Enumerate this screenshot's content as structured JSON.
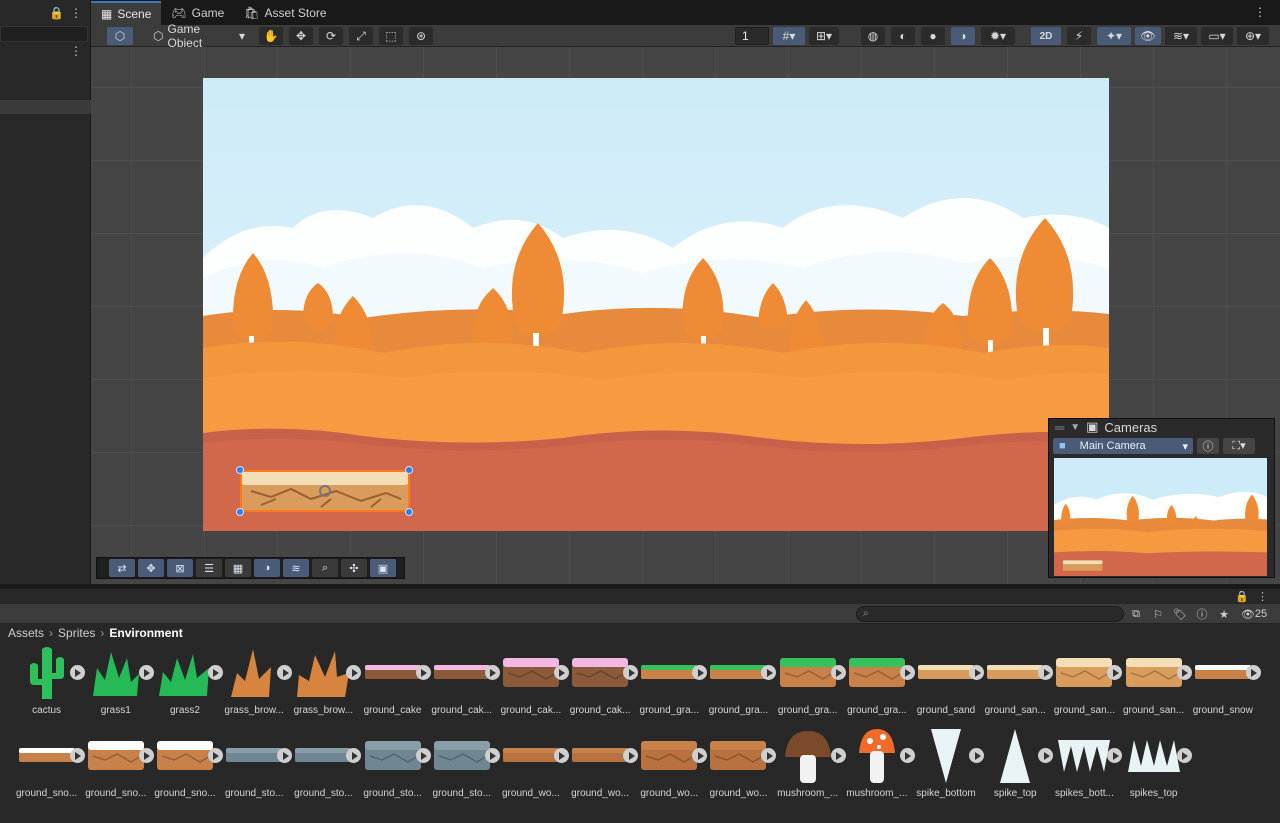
{
  "tabs": [
    {
      "label": "Scene",
      "active": true,
      "icon": "grid-icon"
    },
    {
      "label": "Game",
      "active": false,
      "icon": "gamepad-icon"
    },
    {
      "label": "Asset Store",
      "active": false,
      "icon": "bag-icon"
    }
  ],
  "toolbar": {
    "tool_context": "Game Object",
    "grid_size": "1",
    "mode_2d": "2D"
  },
  "cameras": {
    "title": "Cameras",
    "selected": "Main Camera"
  },
  "breadcrumb": {
    "root": "Assets",
    "middle": "Sprites",
    "current": "Environment"
  },
  "project": {
    "visible_count": "25"
  },
  "assets": [
    {
      "label": "cactus",
      "kind": "cactus"
    },
    {
      "label": "grass1",
      "kind": "grass-green"
    },
    {
      "label": "grass2",
      "kind": "grass-green2"
    },
    {
      "label": "grass_brow...",
      "kind": "grass-brown"
    },
    {
      "label": "grass_brow...",
      "kind": "grass-brown2"
    },
    {
      "label": "ground_cake",
      "kind": "thin-pink"
    },
    {
      "label": "ground_cak...",
      "kind": "thin-pink"
    },
    {
      "label": "ground_cak...",
      "kind": "block-pink"
    },
    {
      "label": "ground_cak...",
      "kind": "block-pink"
    },
    {
      "label": "ground_gra...",
      "kind": "thin-green"
    },
    {
      "label": "ground_gra...",
      "kind": "thin-green"
    },
    {
      "label": "ground_gra...",
      "kind": "block-green"
    },
    {
      "label": "ground_gra...",
      "kind": "block-green"
    },
    {
      "label": "ground_sand",
      "kind": "thin-sand"
    },
    {
      "label": "ground_san...",
      "kind": "thin-sand"
    },
    {
      "label": "ground_san...",
      "kind": "block-sand"
    },
    {
      "label": "ground_san...",
      "kind": "block-sand"
    },
    {
      "label": "ground_snow",
      "kind": "thin-snow"
    },
    {
      "label": "ground_sno...",
      "kind": "thin-snow"
    },
    {
      "label": "ground_sno...",
      "kind": "block-snow"
    },
    {
      "label": "ground_sno...",
      "kind": "block-snow"
    },
    {
      "label": "ground_sto...",
      "kind": "thin-stone"
    },
    {
      "label": "ground_sto...",
      "kind": "thin-stone"
    },
    {
      "label": "ground_sto...",
      "kind": "block-stone"
    },
    {
      "label": "ground_sto...",
      "kind": "block-stone"
    },
    {
      "label": "ground_wo...",
      "kind": "thin-wood"
    },
    {
      "label": "ground_wo...",
      "kind": "thin-wood"
    },
    {
      "label": "ground_wo...",
      "kind": "block-wood"
    },
    {
      "label": "ground_wo...",
      "kind": "block-wood"
    },
    {
      "label": "mushroom_...",
      "kind": "mushroom-brown"
    },
    {
      "label": "mushroom_...",
      "kind": "mushroom-red"
    },
    {
      "label": "spike_bottom",
      "kind": "spike-down"
    },
    {
      "label": "spike_top",
      "kind": "spike-up"
    },
    {
      "label": "spikes_bott...",
      "kind": "spikes-down"
    },
    {
      "label": "spikes_top",
      "kind": "spikes-up"
    }
  ],
  "colors": {
    "accent": "#3a79bb",
    "selection": "#ff7a1a",
    "sky": "#cdebf8",
    "hills_far": "#e98a3a",
    "hills_mid": "#f4963c",
    "ground": "#d2684b"
  }
}
